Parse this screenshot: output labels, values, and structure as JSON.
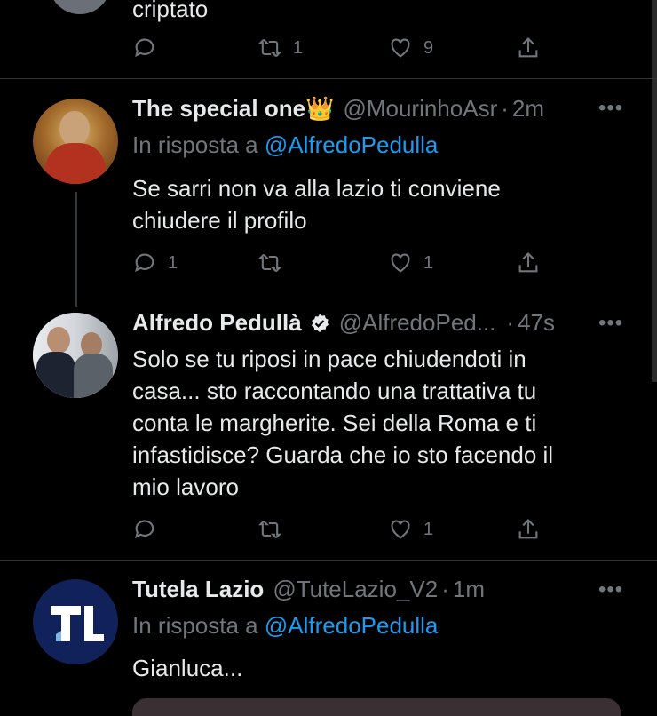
{
  "tweet0": {
    "text_tail": "criptato",
    "reply_count": "",
    "retweet_count": "1",
    "like_count": "9"
  },
  "tweet1": {
    "name": "The special one",
    "crown": "👑",
    "handle": "@MourinhoAsr",
    "sep": "·",
    "time": "2m",
    "reply_prefix": "In risposta a",
    "reply_to": "@AlfredoPedulla",
    "text_line1": "Se sarri non va alla lazio ti conviene",
    "text_line2": "chiudere il profilo",
    "reply_count": "1",
    "retweet_count": "",
    "like_count": "1"
  },
  "tweet2": {
    "name": "Alfredo Pedullà",
    "handle": "@AlfredoPed...",
    "sep": "·",
    "time": "47s",
    "text_line1": "Solo se tu riposi in pace chiudendoti in",
    "text_line2": "casa... sto raccontando una trattativa tu",
    "text_line3": "conta le margherite. Sei della Roma e ti",
    "text_line4": "infastidisce? Guarda che io sto facendo il",
    "text_line5": "mio lavoro",
    "reply_count": "",
    "retweet_count": "",
    "like_count": "1"
  },
  "tweet3": {
    "name": "Tutela Lazio",
    "handle": "@TuteLazio_V2",
    "sep": "·",
    "time": "1m",
    "reply_prefix": "In risposta a",
    "reply_to": "@AlfredoPedulla",
    "text": "Gianluca..."
  },
  "more_label": "•••",
  "colors": {
    "background": "#000000",
    "accent": "#1d9bf0",
    "muted": "#71767b",
    "verified": "#e7e9ea"
  }
}
